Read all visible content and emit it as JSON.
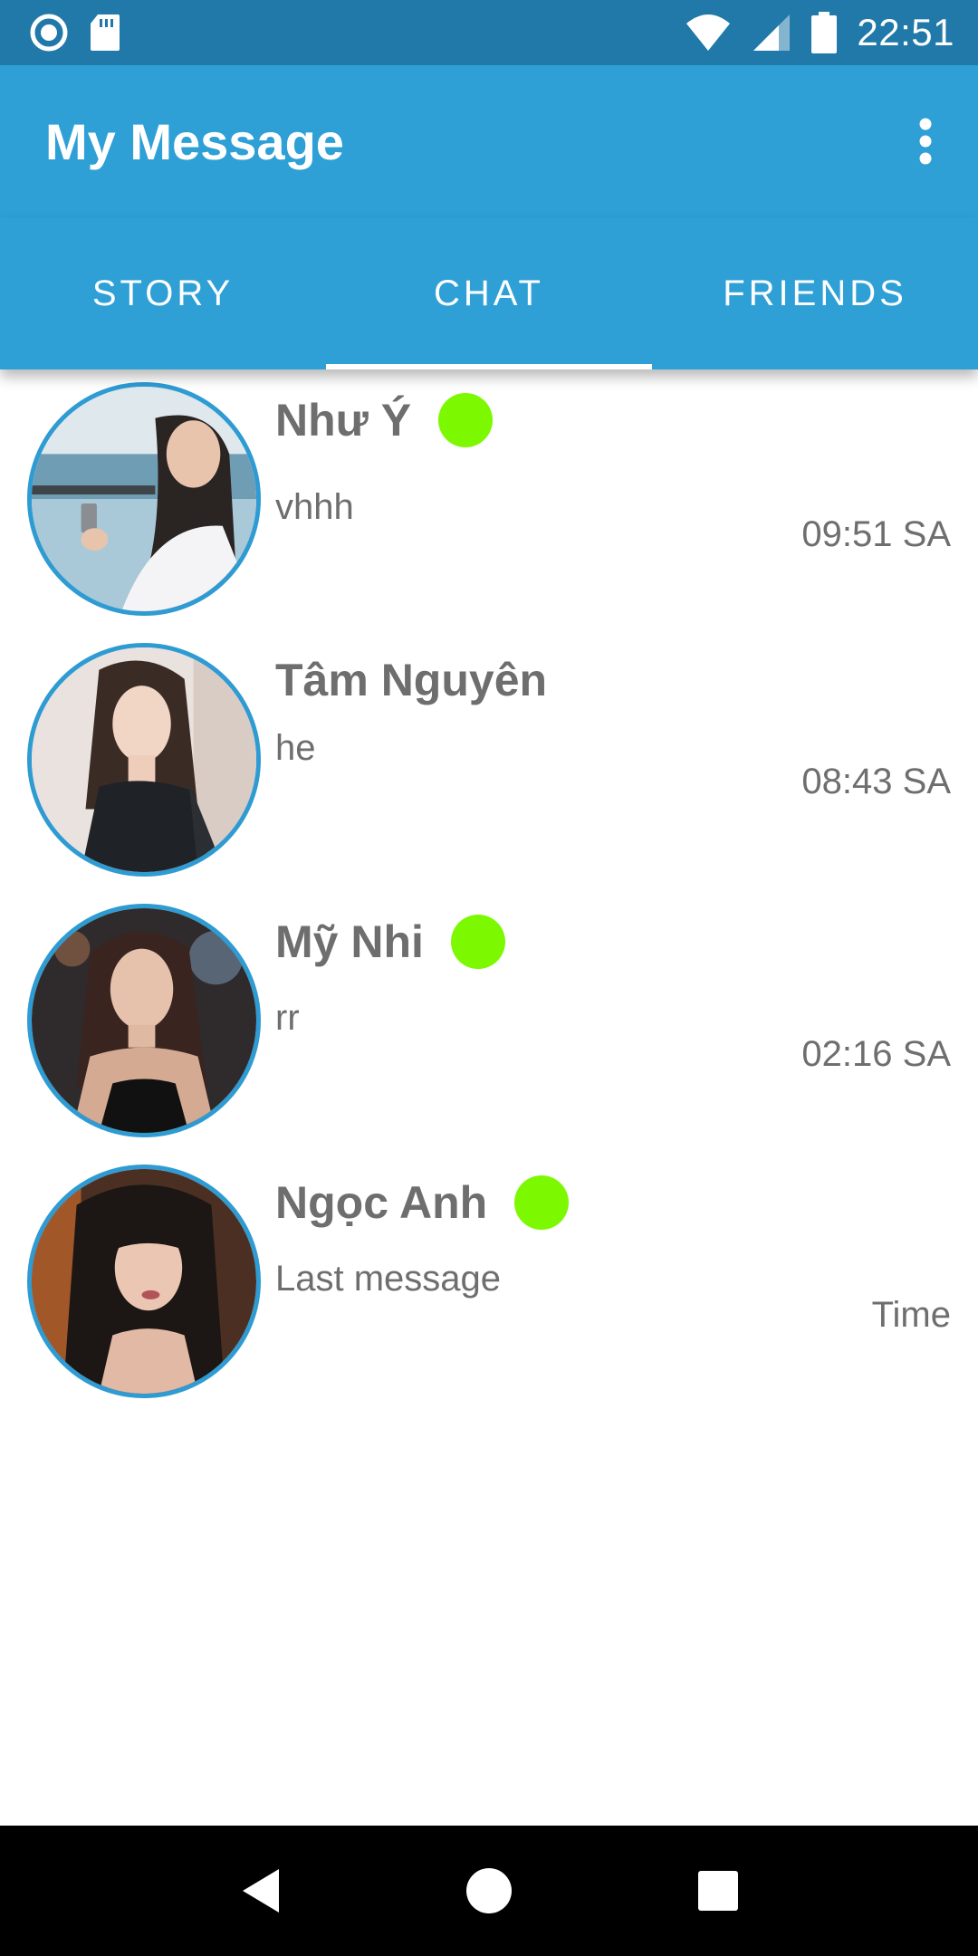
{
  "status_bar": {
    "time": "22:51",
    "icons": [
      "sync-icon",
      "sd-card-icon",
      "wifi-icon",
      "signal-icon",
      "battery-icon"
    ]
  },
  "app_bar": {
    "title": "My Message",
    "menu_icon": "more-vert-icon"
  },
  "tabs": [
    {
      "label": "STORY",
      "active": false
    },
    {
      "label": "CHAT",
      "active": true
    },
    {
      "label": "FRIENDS",
      "active": false
    }
  ],
  "chats": [
    {
      "name": "Như Ý",
      "last_message": "vhhh",
      "time": "09:51 SA",
      "online": true
    },
    {
      "name": "Tâm Nguyên",
      "last_message": "he",
      "time": "08:43 SA",
      "online": false
    },
    {
      "name": "Mỹ Nhi",
      "last_message": "rr",
      "time": "02:16 SA",
      "online": true
    },
    {
      "name": "Ngọc Anh",
      "last_message": "Last message",
      "time": "Time",
      "online": true
    }
  ],
  "nav_bar": {
    "icons": [
      "back-icon",
      "home-icon",
      "recents-icon"
    ]
  },
  "colors": {
    "status_bar": "#2079a8",
    "primary": "#2ea0d6",
    "avatar_border": "#2e9bd3",
    "online": "#7cf900",
    "text_secondary": "#6e6e6e"
  }
}
